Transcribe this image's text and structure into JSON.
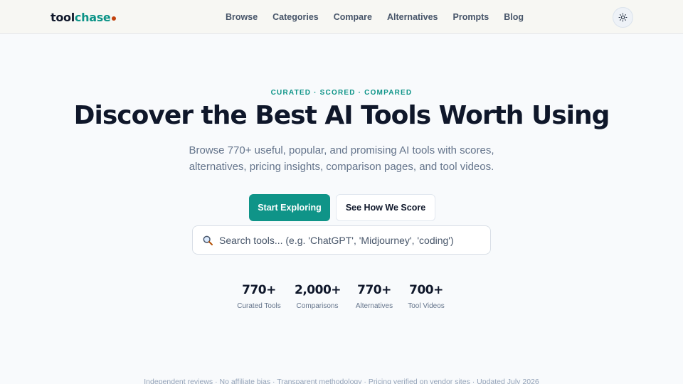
{
  "header": {
    "logo": {
      "part1": "tool",
      "part2": "chase"
    },
    "nav": [
      "Browse",
      "Categories",
      "Compare",
      "Alternatives",
      "Prompts",
      "Blog"
    ],
    "theme_toggle_icon": "sun-icon"
  },
  "hero": {
    "eyebrow": "CURATED · SCORED · COMPARED",
    "title": "Discover the Best AI Tools Worth Using",
    "subtitle_line1": "Browse 770+ useful, popular, and promising AI tools with scores,",
    "subtitle_line2": "alternatives, pricing insights, comparison pages, and tool videos.",
    "primary_button": "Start Exploring",
    "secondary_button": "See How We Score",
    "search_placeholder": "Search tools... (e.g. 'ChatGPT', 'Midjourney', 'coding')",
    "search_icon": "magnifier-icon"
  },
  "stats": [
    {
      "value": "770+",
      "label": "Curated Tools"
    },
    {
      "value": "2,000+",
      "label": "Comparisons"
    },
    {
      "value": "770+",
      "label": "Alternatives"
    },
    {
      "value": "700+",
      "label": "Tool Videos"
    }
  ],
  "footer_note": "Independent reviews · No affiliate bias · Transparent methodology · Pricing verified on vendor sites · Updated July 2026",
  "colors": {
    "accent": "#0f9488",
    "logo_dot": "#c2410c",
    "text": "#0f172a",
    "muted": "#64748b"
  }
}
